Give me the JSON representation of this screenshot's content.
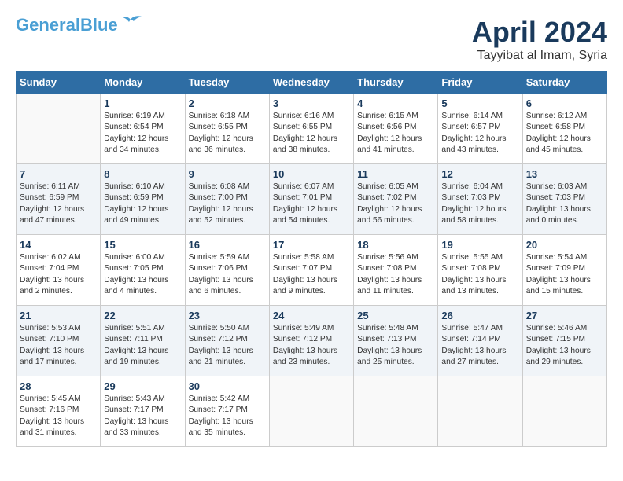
{
  "header": {
    "logo_line1": "General",
    "logo_line2": "Blue",
    "month_year": "April 2024",
    "location": "Tayyibat al Imam, Syria"
  },
  "days_of_week": [
    "Sunday",
    "Monday",
    "Tuesday",
    "Wednesday",
    "Thursday",
    "Friday",
    "Saturday"
  ],
  "weeks": [
    [
      {
        "day": "",
        "info": ""
      },
      {
        "day": "1",
        "info": "Sunrise: 6:19 AM\nSunset: 6:54 PM\nDaylight: 12 hours\nand 34 minutes."
      },
      {
        "day": "2",
        "info": "Sunrise: 6:18 AM\nSunset: 6:55 PM\nDaylight: 12 hours\nand 36 minutes."
      },
      {
        "day": "3",
        "info": "Sunrise: 6:16 AM\nSunset: 6:55 PM\nDaylight: 12 hours\nand 38 minutes."
      },
      {
        "day": "4",
        "info": "Sunrise: 6:15 AM\nSunset: 6:56 PM\nDaylight: 12 hours\nand 41 minutes."
      },
      {
        "day": "5",
        "info": "Sunrise: 6:14 AM\nSunset: 6:57 PM\nDaylight: 12 hours\nand 43 minutes."
      },
      {
        "day": "6",
        "info": "Sunrise: 6:12 AM\nSunset: 6:58 PM\nDaylight: 12 hours\nand 45 minutes."
      }
    ],
    [
      {
        "day": "7",
        "info": "Sunrise: 6:11 AM\nSunset: 6:59 PM\nDaylight: 12 hours\nand 47 minutes."
      },
      {
        "day": "8",
        "info": "Sunrise: 6:10 AM\nSunset: 6:59 PM\nDaylight: 12 hours\nand 49 minutes."
      },
      {
        "day": "9",
        "info": "Sunrise: 6:08 AM\nSunset: 7:00 PM\nDaylight: 12 hours\nand 52 minutes."
      },
      {
        "day": "10",
        "info": "Sunrise: 6:07 AM\nSunset: 7:01 PM\nDaylight: 12 hours\nand 54 minutes."
      },
      {
        "day": "11",
        "info": "Sunrise: 6:05 AM\nSunset: 7:02 PM\nDaylight: 12 hours\nand 56 minutes."
      },
      {
        "day": "12",
        "info": "Sunrise: 6:04 AM\nSunset: 7:03 PM\nDaylight: 12 hours\nand 58 minutes."
      },
      {
        "day": "13",
        "info": "Sunrise: 6:03 AM\nSunset: 7:03 PM\nDaylight: 13 hours\nand 0 minutes."
      }
    ],
    [
      {
        "day": "14",
        "info": "Sunrise: 6:02 AM\nSunset: 7:04 PM\nDaylight: 13 hours\nand 2 minutes."
      },
      {
        "day": "15",
        "info": "Sunrise: 6:00 AM\nSunset: 7:05 PM\nDaylight: 13 hours\nand 4 minutes."
      },
      {
        "day": "16",
        "info": "Sunrise: 5:59 AM\nSunset: 7:06 PM\nDaylight: 13 hours\nand 6 minutes."
      },
      {
        "day": "17",
        "info": "Sunrise: 5:58 AM\nSunset: 7:07 PM\nDaylight: 13 hours\nand 9 minutes."
      },
      {
        "day": "18",
        "info": "Sunrise: 5:56 AM\nSunset: 7:08 PM\nDaylight: 13 hours\nand 11 minutes."
      },
      {
        "day": "19",
        "info": "Sunrise: 5:55 AM\nSunset: 7:08 PM\nDaylight: 13 hours\nand 13 minutes."
      },
      {
        "day": "20",
        "info": "Sunrise: 5:54 AM\nSunset: 7:09 PM\nDaylight: 13 hours\nand 15 minutes."
      }
    ],
    [
      {
        "day": "21",
        "info": "Sunrise: 5:53 AM\nSunset: 7:10 PM\nDaylight: 13 hours\nand 17 minutes."
      },
      {
        "day": "22",
        "info": "Sunrise: 5:51 AM\nSunset: 7:11 PM\nDaylight: 13 hours\nand 19 minutes."
      },
      {
        "day": "23",
        "info": "Sunrise: 5:50 AM\nSunset: 7:12 PM\nDaylight: 13 hours\nand 21 minutes."
      },
      {
        "day": "24",
        "info": "Sunrise: 5:49 AM\nSunset: 7:12 PM\nDaylight: 13 hours\nand 23 minutes."
      },
      {
        "day": "25",
        "info": "Sunrise: 5:48 AM\nSunset: 7:13 PM\nDaylight: 13 hours\nand 25 minutes."
      },
      {
        "day": "26",
        "info": "Sunrise: 5:47 AM\nSunset: 7:14 PM\nDaylight: 13 hours\nand 27 minutes."
      },
      {
        "day": "27",
        "info": "Sunrise: 5:46 AM\nSunset: 7:15 PM\nDaylight: 13 hours\nand 29 minutes."
      }
    ],
    [
      {
        "day": "28",
        "info": "Sunrise: 5:45 AM\nSunset: 7:16 PM\nDaylight: 13 hours\nand 31 minutes."
      },
      {
        "day": "29",
        "info": "Sunrise: 5:43 AM\nSunset: 7:17 PM\nDaylight: 13 hours\nand 33 minutes."
      },
      {
        "day": "30",
        "info": "Sunrise: 5:42 AM\nSunset: 7:17 PM\nDaylight: 13 hours\nand 35 minutes."
      },
      {
        "day": "",
        "info": ""
      },
      {
        "day": "",
        "info": ""
      },
      {
        "day": "",
        "info": ""
      },
      {
        "day": "",
        "info": ""
      }
    ]
  ]
}
